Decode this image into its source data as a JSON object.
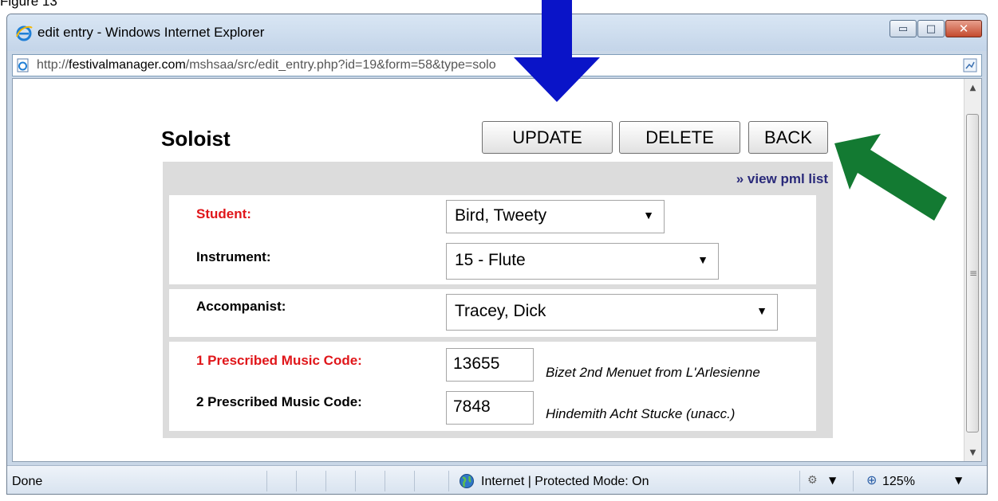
{
  "caption": "Figure 13",
  "window": {
    "title": "edit entry - Windows Internet Explorer",
    "controls": {
      "minimize": "▭",
      "maximize": "□",
      "close": "✕"
    }
  },
  "address": {
    "prefix": "http://",
    "domain": "festivalmanager.com",
    "path": "/mshsaa/src/edit_entry.php?id=19&form=58&type=solo"
  },
  "page": {
    "title": "Soloist",
    "buttons": {
      "update": "UPDATE",
      "delete": "DELETE",
      "back": "BACK"
    },
    "view_link": "» view pml list",
    "student": {
      "label": "Student:",
      "value": "Bird, Tweety"
    },
    "instrument": {
      "label": "Instrument:",
      "value": "15 - Flute"
    },
    "accompanist": {
      "label": "Accompanist:",
      "value": "Tracey, Dick"
    },
    "music1": {
      "label": "1 Prescribed Music Code:",
      "code": "13655",
      "desc": "Bizet 2nd Menuet from L'Arlesienne"
    },
    "music2": {
      "label": "2 Prescribed Music Code:",
      "code": "7848",
      "desc": "Hindemith Acht Stucke (unacc.)"
    }
  },
  "status": {
    "text": "Done",
    "zone": "Internet | Protected Mode: On",
    "zoom": "125%"
  },
  "colors": {
    "required_label": "#e0161a",
    "link": "#2a2a7a",
    "annotation_blue": "#0a14c8",
    "annotation_green": "#137a32"
  },
  "icons": [
    "ie-logo-icon",
    "page-icon",
    "rss-icon",
    "globe-icon",
    "security-icon",
    "zoom-icon",
    "dropdown-arrow-icon"
  ]
}
